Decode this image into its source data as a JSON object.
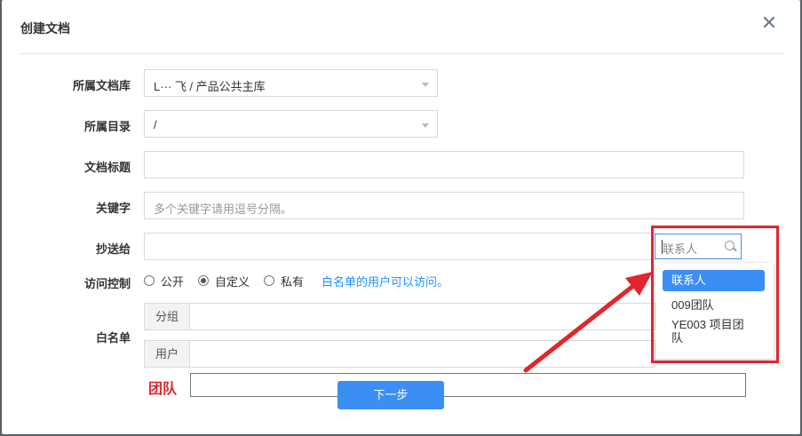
{
  "dialog": {
    "title": "创建文档"
  },
  "form": {
    "library_label": "所属文档库",
    "library_value": "L··· 飞 / 产品公共主库",
    "directory_label": "所属目录",
    "directory_value": "/",
    "doc_title_label": "文档标题",
    "keywords_label": "关键字",
    "keywords_placeholder": "多个关键字请用逗号分隔。",
    "cc_label": "抄送给",
    "access_label": "访问控制",
    "access_options": [
      "公开",
      "自定义",
      "私有"
    ],
    "access_selected": "自定义",
    "access_hint": "白名单的用户可以访问。",
    "whitelist_label": "白名单",
    "group_label": "分组",
    "user_label": "用户",
    "team_label": "团队"
  },
  "search": {
    "placeholder": "联系人"
  },
  "dropdown": {
    "items": [
      "联系人",
      "009团队",
      "YE003 项目团队"
    ]
  },
  "footer": {
    "next_label": "下一步"
  },
  "colors": {
    "accent": "#3b8ef3",
    "annotation": "#e1262d"
  }
}
